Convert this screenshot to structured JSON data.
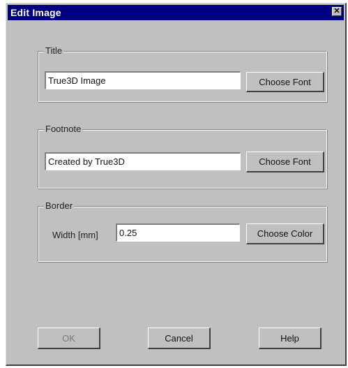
{
  "window": {
    "title": "Edit Image",
    "close_glyph": "✕"
  },
  "title_group": {
    "label": "Title",
    "text_value": "True3D Image",
    "font_button": "Choose Font"
  },
  "footnote_group": {
    "label": "Footnote",
    "text_value": "Created by True3D",
    "font_button": "Choose Font"
  },
  "border_group": {
    "label": "Border",
    "width_label": "Width [mm]",
    "width_value": "0.25",
    "color_button": "Choose Color"
  },
  "buttons": {
    "ok": "OK",
    "cancel": "Cancel",
    "help": "Help"
  }
}
